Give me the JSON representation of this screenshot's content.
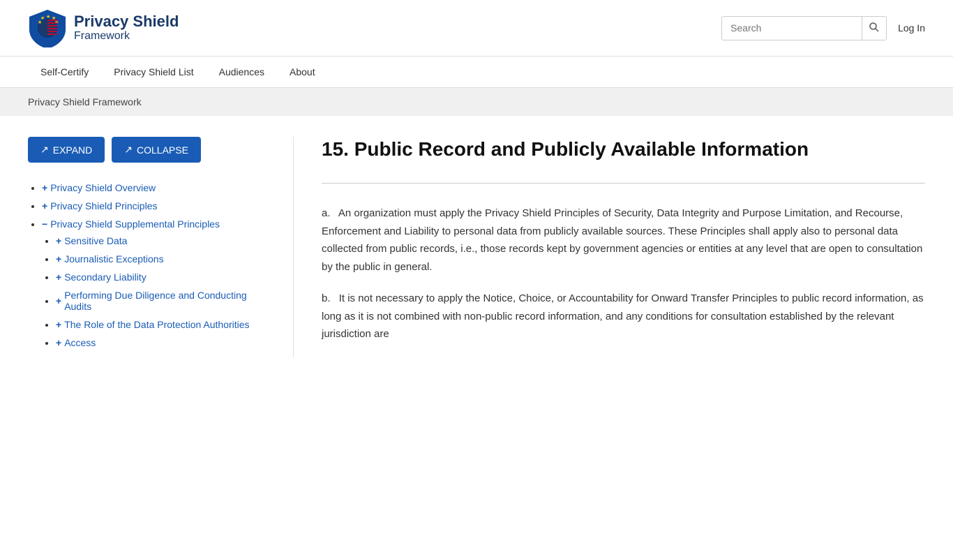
{
  "header": {
    "logo_title": "Privacy Shield",
    "logo_subtitle": "Framework",
    "search_placeholder": "Search",
    "login_label": "Log In"
  },
  "nav": {
    "items": [
      {
        "label": "Self-Certify",
        "id": "self-certify"
      },
      {
        "label": "Privacy Shield List",
        "id": "privacy-shield-list"
      },
      {
        "label": "Audiences",
        "id": "audiences"
      },
      {
        "label": "About",
        "id": "about"
      }
    ]
  },
  "breadcrumb": "Privacy Shield Framework",
  "sidebar": {
    "expand_label": "EXPAND",
    "collapse_label": "COLLAPSE",
    "expand_icon": "↗",
    "collapse_icon": "↗",
    "nav_items": [
      {
        "label": "Privacy Shield Overview",
        "icon": "+",
        "id": "overview",
        "expanded": false
      },
      {
        "label": "Privacy Shield Principles",
        "icon": "+",
        "id": "principles",
        "expanded": false
      },
      {
        "label": "Privacy Shield Supplemental Principles",
        "icon": "−",
        "id": "supplemental",
        "expanded": true,
        "children": [
          {
            "label": "Sensitive Data",
            "icon": "+",
            "id": "sensitive-data"
          },
          {
            "label": "Journalistic Exceptions",
            "icon": "+",
            "id": "journalistic"
          },
          {
            "label": "Secondary Liability",
            "icon": "+",
            "id": "secondary"
          },
          {
            "label": "Performing Due Diligence and Conducting Audits",
            "icon": "+",
            "id": "due-diligence"
          },
          {
            "label": "The Role of the Data Protection Authorities",
            "icon": "+",
            "id": "dpa-role"
          },
          {
            "label": "Access",
            "icon": "+",
            "id": "access"
          }
        ]
      }
    ]
  },
  "content": {
    "title": "15. Public Record and Publicly Available Information",
    "paragraphs": [
      {
        "label": "a.",
        "text": "An organization must apply the Privacy Shield Principles of Security, Data Integrity and Purpose Limitation, and Recourse, Enforcement and Liability to personal data from publicly available sources.  These Principles shall apply also to personal data collected from public records, i.e., those records kept by government agencies or entities at any level that are open to consultation by the public in general."
      },
      {
        "label": "b.",
        "text": "It is not necessary to apply the Notice, Choice, or Accountability for Onward Transfer Principles to public record information, as long as it is not combined with non-public record information, and any conditions for consultation established by the relevant jurisdiction are"
      }
    ]
  },
  "colors": {
    "primary_blue": "#1a5cb5",
    "dark_blue": "#1a3a6b",
    "bg_gray": "#f0f0f0",
    "border_gray": "#ddd"
  }
}
